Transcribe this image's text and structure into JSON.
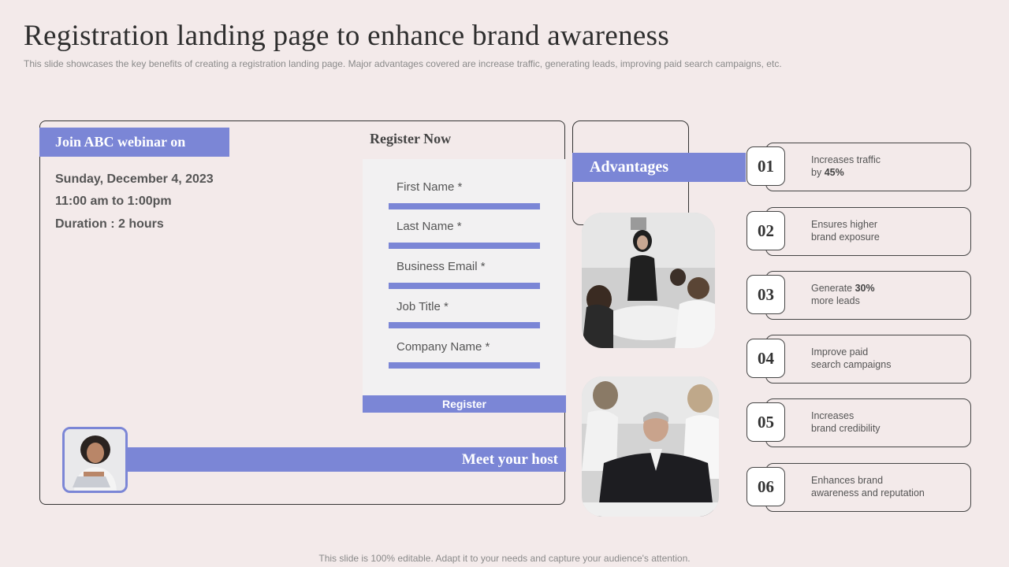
{
  "title": "Registration landing page to enhance brand awareness",
  "subtitle": "This slide showcases the key benefits of creating a registration landing page. Major advantages covered are increase traffic, generating leads, improving paid search campaigns, etc.",
  "footer": "This slide is 100% editable. Adapt it to your needs and capture your audience's attention.",
  "webinar": {
    "banner": "Join ABC webinar on",
    "date": "Sunday, December 4, 2023",
    "time": "11:00 am to 1:00pm",
    "duration": "Duration : 2 hours",
    "host_label": "Meet your host"
  },
  "form": {
    "title": "Register Now",
    "fields": [
      "First Name *",
      "Last Name *",
      "Business Email *",
      "Job Title *",
      "Company Name *"
    ],
    "button": "Register"
  },
  "advantages": {
    "title": "Advantages",
    "items": [
      {
        "num": "01",
        "line1": "Increases traffic",
        "line2_pre": "by ",
        "line2_bold": "45%",
        "line2_post": ""
      },
      {
        "num": "02",
        "line1": "Ensures higher",
        "line2_pre": "brand exposure",
        "line2_bold": "",
        "line2_post": ""
      },
      {
        "num": "03",
        "line1_pre": "Generate ",
        "line1_bold": "30%",
        "line2_pre": "more leads",
        "line2_bold": "",
        "line2_post": ""
      },
      {
        "num": "04",
        "line1": "Improve  paid",
        "line2_pre": "search campaigns",
        "line2_bold": "",
        "line2_post": ""
      },
      {
        "num": "05",
        "line1": "Increases",
        "line2_pre": "brand credibility",
        "line2_bold": "",
        "line2_post": ""
      },
      {
        "num": "06",
        "line1": "Enhances brand",
        "line2_pre": "awareness  and reputation",
        "line2_bold": "",
        "line2_post": ""
      }
    ]
  },
  "colors": {
    "accent": "#7b86d6",
    "background": "#f3eaea"
  }
}
